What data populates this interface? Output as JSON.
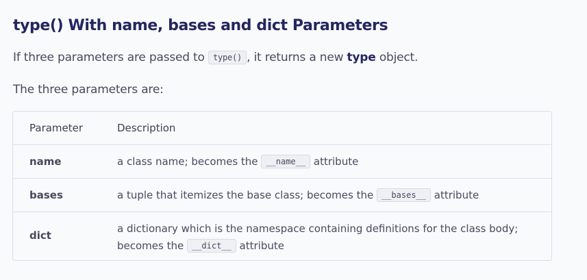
{
  "heading": "type() With name, bases and dict Parameters",
  "intro": {
    "before": "If three parameters are passed to ",
    "code": "type()",
    "middle": ", it returns a new ",
    "bold": "type",
    "after": " object."
  },
  "subtext": "The three parameters are:",
  "table": {
    "headers": [
      "Parameter",
      "Description"
    ],
    "rows": [
      {
        "name": "name",
        "desc_before": "a class name; becomes the ",
        "code": "__name__",
        "desc_after": " attribute"
      },
      {
        "name": "bases",
        "desc_before": "a tuple that itemizes the base class; becomes the ",
        "code": "__bases__",
        "desc_after": " attribute"
      },
      {
        "name": "dict",
        "desc_before": "a dictionary which is the namespace containing definitions for the class body; becomes the ",
        "code": "__dict__",
        "desc_after": " attribute"
      }
    ]
  }
}
